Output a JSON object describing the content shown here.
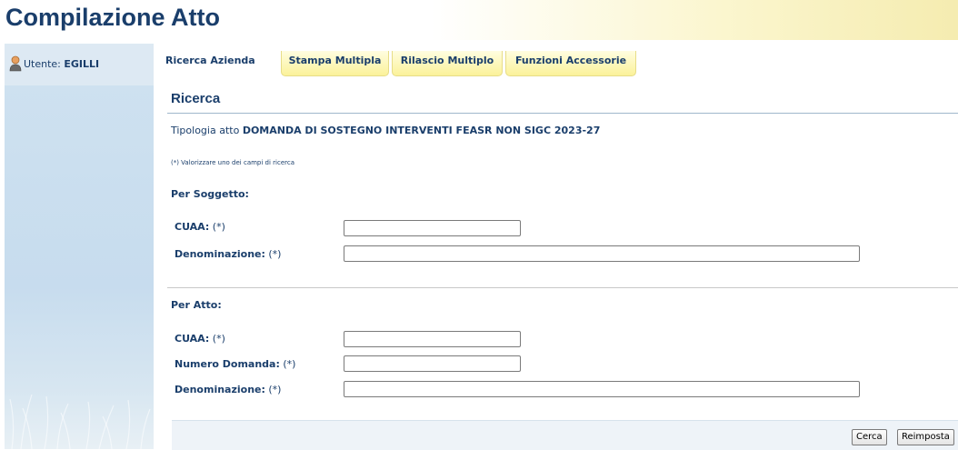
{
  "header": {
    "title": "Compilazione Atto"
  },
  "sidebar": {
    "user_label": "Utente:",
    "user_name": "EGILLI"
  },
  "tabs": [
    {
      "label": "Ricerca Azienda",
      "active": true
    },
    {
      "label": "Stampa Multipla",
      "active": false
    },
    {
      "label": "Rilascio Multiplo",
      "active": false
    },
    {
      "label": "Funzioni Accessorie",
      "active": false
    }
  ],
  "main": {
    "section_title": "Ricerca",
    "tipologia_label": "Tipologia atto",
    "tipologia_value": "DOMANDA DI SOSTEGNO INTERVENTI FEASR NON SIGC 2023-27",
    "note": "(*) Valorizzare uno dei campi di ricerca",
    "required_marker": "(*)",
    "per_soggetto": {
      "title": "Per Soggetto:",
      "cuaa_label": "CUAA:",
      "cuaa_value": "",
      "denominazione_label": "Denominazione:",
      "denominazione_value": ""
    },
    "per_atto": {
      "title": "Per Atto:",
      "cuaa_label": "CUAA:",
      "cuaa_value": "",
      "numero_domanda_label": "Numero Domanda:",
      "numero_domanda_value": "",
      "denominazione_label": "Denominazione:",
      "denominazione_value": ""
    }
  },
  "buttons": {
    "cerca": "Cerca",
    "reimposta": "Reimposta"
  },
  "colors": {
    "primary_text": "#1a3e6b",
    "tab_yellow": "#fbf29a",
    "sidebar_blue": "#cfe2f0",
    "header_gradient_end": "#f5ecb0"
  },
  "icons": {
    "user": "user-icon"
  }
}
